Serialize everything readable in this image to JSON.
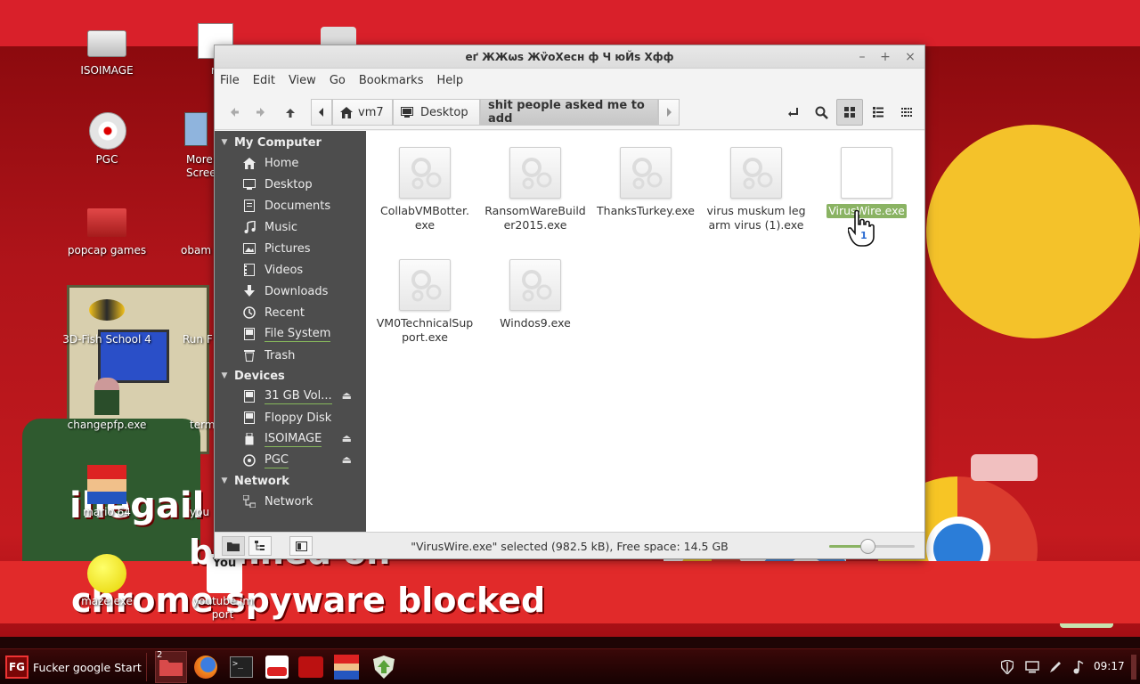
{
  "window": {
    "title": "еґ ЖЖѡs ЖѷоХесн ф Ч юЙѕ Хфф",
    "min": "–",
    "max": "+",
    "close": "×"
  },
  "menu": [
    "File",
    "Edit",
    "View",
    "Go",
    "Bookmarks",
    "Help"
  ],
  "breadcrumbs": [
    {
      "label": "vm7",
      "icon": "home-icon"
    },
    {
      "label": "Desktop",
      "icon": "desktop-icon"
    },
    {
      "label": "shit people asked me to add",
      "icon": ""
    }
  ],
  "sidebar": {
    "sections": [
      {
        "title": "My Computer",
        "items": [
          {
            "label": "Home",
            "icon": "home-icon"
          },
          {
            "label": "Desktop",
            "icon": "desktop-icon"
          },
          {
            "label": "Documents",
            "icon": "documents-icon"
          },
          {
            "label": "Music",
            "icon": "music-icon"
          },
          {
            "label": "Pictures",
            "icon": "pictures-icon"
          },
          {
            "label": "Videos",
            "icon": "videos-icon"
          },
          {
            "label": "Downloads",
            "icon": "downloads-icon"
          },
          {
            "label": "Recent",
            "icon": "recent-icon"
          },
          {
            "label": "File System",
            "icon": "drive-icon"
          },
          {
            "label": "Trash",
            "icon": "trash-icon"
          }
        ]
      },
      {
        "title": "Devices",
        "items": [
          {
            "label": "31 GB Vol...",
            "icon": "drive-icon"
          },
          {
            "label": "Floppy Disk",
            "icon": "drive-icon"
          },
          {
            "label": "ISOIMAGE",
            "icon": "usb-icon"
          },
          {
            "label": "PGC",
            "icon": "disc-icon"
          }
        ]
      },
      {
        "title": "Network",
        "items": [
          {
            "label": "Network",
            "icon": "network-icon"
          }
        ]
      }
    ]
  },
  "files": [
    {
      "name": "CollabVMBotter.\nexe",
      "l1": "CollabVMBotter.",
      "l2": "exe"
    },
    {
      "l1": "RansomWareBuild",
      "l2": "er2015.exe"
    },
    {
      "l1": "ThanksTurkey.exe",
      "l2": ""
    },
    {
      "l1": "virus muskum leg",
      "l2": "arm virus (1).exe"
    },
    {
      "l1": "VirusWire.exe",
      "l2": "",
      "selected": true
    },
    {
      "l1": "VM0TechnicalSup",
      "l2": "port.exe"
    },
    {
      "l1": "Windos9.exe",
      "l2": ""
    }
  ],
  "status": "\"VirusWire.exe\" selected (982.5 kB), Free space: 14.5 GB",
  "zoom_level": 0.45,
  "desktop_icons": [
    {
      "label": "ISOIMAGE"
    },
    {
      "label": "mines"
    },
    {
      "label": "PGC"
    },
    {
      "label": "More"
    },
    {
      "label": "Scree"
    },
    {
      "label": "popcap games"
    },
    {
      "label": "obam"
    },
    {
      "label": "3D-Fish School 4"
    },
    {
      "label": "Run F"
    },
    {
      "label": "changepfp.exe"
    },
    {
      "label": "term"
    },
    {
      "label": "mario 64"
    },
    {
      "label": "you"
    },
    {
      "label": "maze.exe"
    },
    {
      "label": "youtube.im"
    },
    {
      "label": "port"
    }
  ],
  "wallpaper_text": {
    "line1": "illegail ci",
    "line2": "banned on",
    "line3": "chrome spyware blocked"
  },
  "taskbar": {
    "start_label": "Fucker google Start",
    "start_logo": "FG",
    "badge": "2",
    "clock": "09:17",
    "youtube": "You"
  },
  "colors": {
    "accent": "#8ab363",
    "sidebar": "#4d4d4d",
    "taskbar": "#1e0404"
  }
}
